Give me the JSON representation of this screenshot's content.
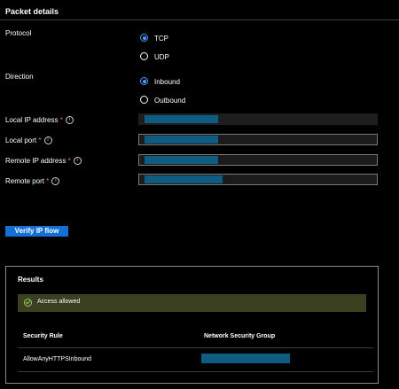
{
  "header": {
    "title": "Packet details"
  },
  "protocol": {
    "label": "Protocol",
    "options": [
      {
        "label": "TCP",
        "checked": true
      },
      {
        "label": "UDP",
        "checked": false
      }
    ]
  },
  "direction": {
    "label": "Direction",
    "options": [
      {
        "label": "Inbound",
        "checked": true
      },
      {
        "label": "Outbound",
        "checked": false
      }
    ]
  },
  "fields": {
    "local_ip": {
      "label": "Local IP address",
      "required_mark": "*",
      "info_icon": "i",
      "value": "",
      "redacted": true
    },
    "local_port": {
      "label": "Local port",
      "required_mark": "*",
      "info_icon": "i",
      "value": "",
      "redacted": true
    },
    "remote_ip": {
      "label": "Remote IP address",
      "required_mark": "*",
      "info_icon": "i",
      "value": "",
      "redacted": true
    },
    "remote_port": {
      "label": "Remote port",
      "required_mark": "*",
      "info_icon": "i",
      "value": "",
      "redacted": true
    }
  },
  "actions": {
    "verify_label": "Verify IP flow"
  },
  "results": {
    "title": "Results",
    "status_text": "Access allowed",
    "columns": [
      "Security Rule",
      "Network Security Group"
    ],
    "rows": [
      {
        "security_rule": "AllowAnyHTTPSInbound",
        "nsg": "",
        "nsg_redacted": true
      }
    ]
  },
  "colors": {
    "accent": "#1570d6",
    "radio_selected": "#4aa0ff",
    "redaction": "#0f5b82",
    "success_banner": "#3a4020",
    "success_icon": "#9ad15a"
  }
}
